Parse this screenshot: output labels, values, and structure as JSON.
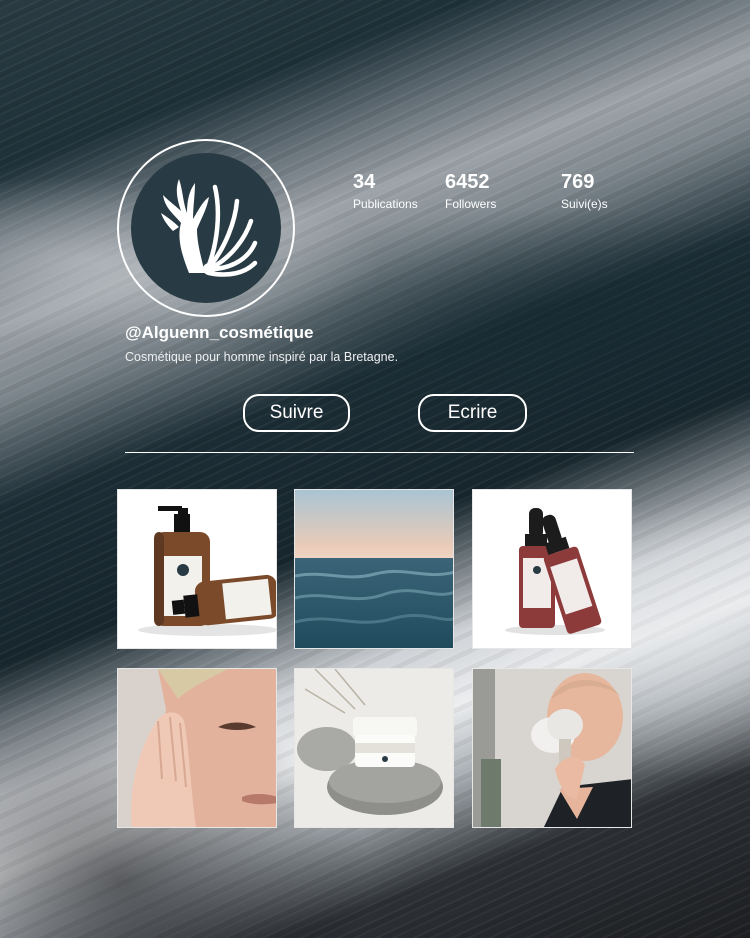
{
  "profile": {
    "handle": "@Alguenn_cosmétique",
    "bio": "Cosmétique pour homme inspiré par la Bretagne.",
    "avatar_icon": "seaweed-shell-logo-icon"
  },
  "stats": [
    {
      "value": "34",
      "label": "Publications"
    },
    {
      "value": "6452",
      "label": "Followers"
    },
    {
      "value": "769",
      "label": "Suivi(e)s"
    }
  ],
  "actions": {
    "follow_label": "Suivre",
    "message_label": "Ecrire"
  },
  "colors": {
    "avatar_bg": "#283a43",
    "ocean": "#3a6b7e",
    "bottle_amber": "#7a4a2a",
    "serum_red": "#8c3b3a"
  },
  "grid": [
    {
      "subject": "amber-pump-bottles-photo"
    },
    {
      "subject": "ocean-waves-photo"
    },
    {
      "subject": "red-serum-dropper-bottles-photo"
    },
    {
      "subject": "man-applying-cream-photo"
    },
    {
      "subject": "cream-jar-on-stones-photo"
    },
    {
      "subject": "man-shaving-brush-photo"
    }
  ]
}
